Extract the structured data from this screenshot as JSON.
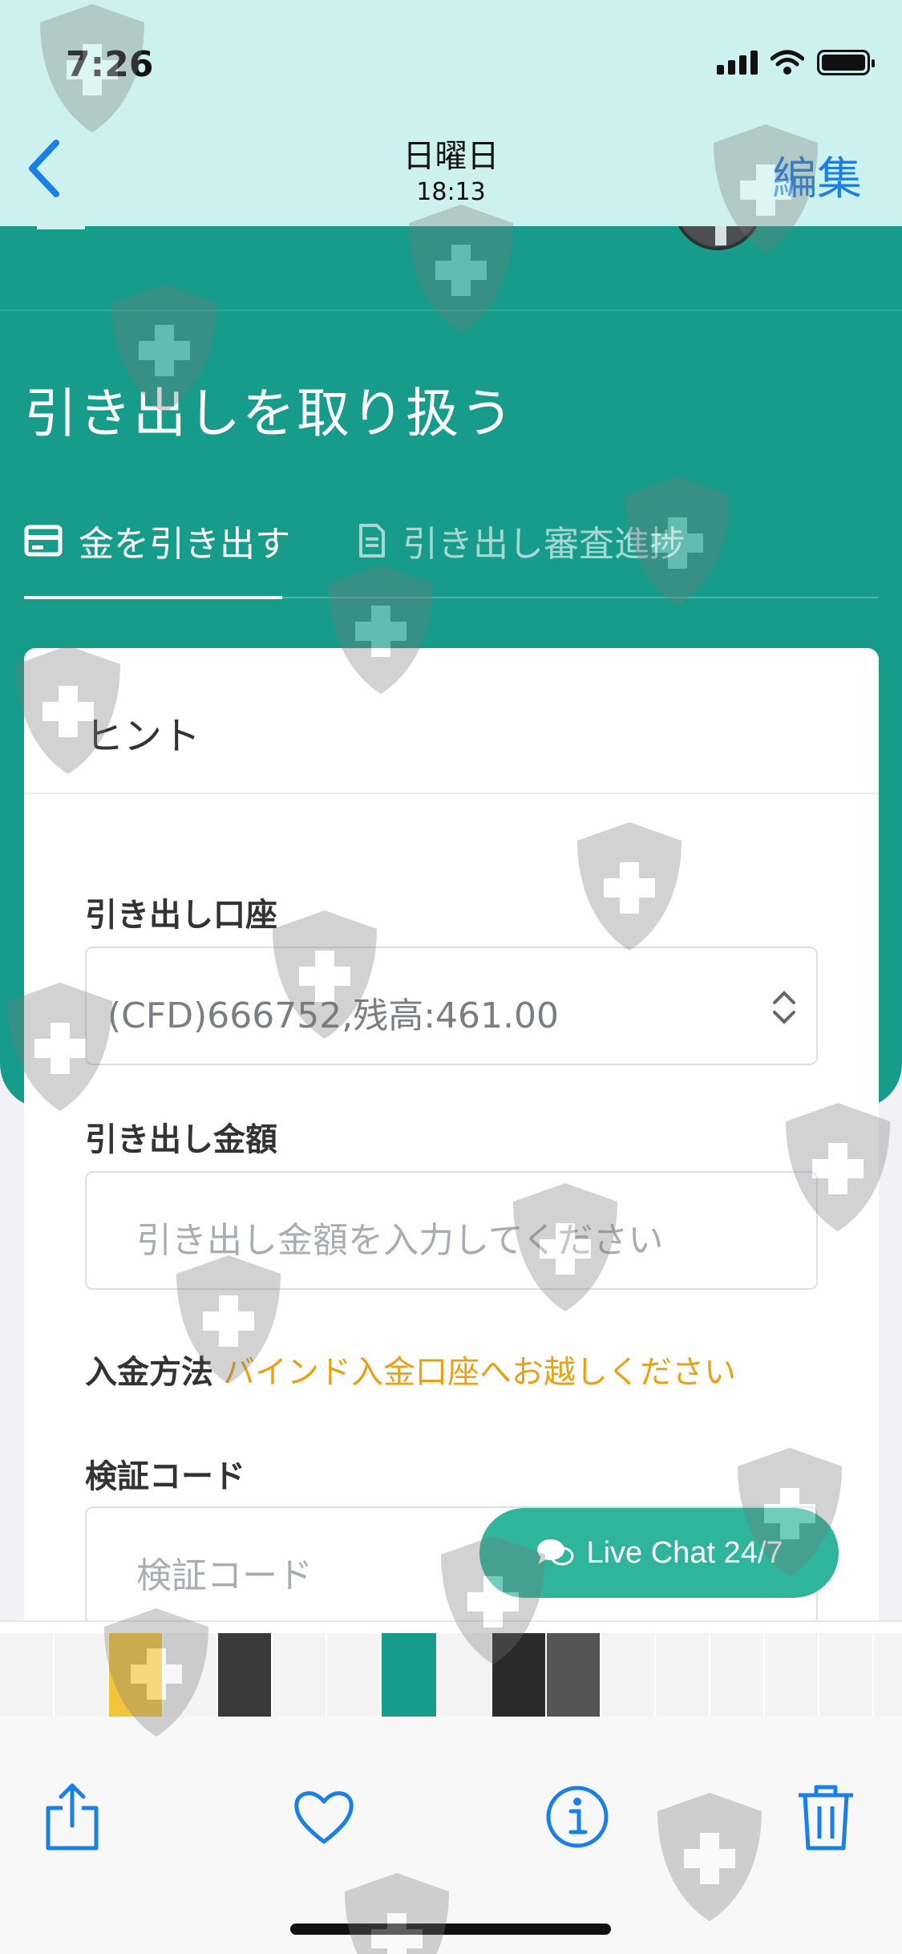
{
  "status_bar": {
    "time": "7:26",
    "icons": [
      "signal-icon",
      "wifi-icon",
      "battery-icon"
    ]
  },
  "photo_nav": {
    "back_icon": "chevron-left-icon",
    "title": "日曜日",
    "subtitle": "18:13",
    "edit_label": "編集"
  },
  "app": {
    "title": "引き出しを取り扱う",
    "tabs": [
      {
        "icon": "credit-card-icon",
        "label": "金を引き出す",
        "active": true
      },
      {
        "icon": "document-icon",
        "label": "引き出し審査進捗",
        "active": false
      }
    ],
    "card": {
      "header": "ヒント",
      "account_label": "引き出し口座",
      "account_value": "(CFD)666752,残高:461.00",
      "amount_label": "引き出し金額",
      "amount_placeholder": "引き出し金額を入力してください",
      "method_label": "入金方法",
      "method_value": "バインド入金口座へお越しください",
      "code_label": "検証コード",
      "code_placeholder": "検証コード"
    },
    "chat_button": "Live Chat 24/7"
  },
  "toolbar": {
    "icons": [
      "share-icon",
      "heart-icon",
      "info-icon",
      "trash-icon"
    ]
  },
  "colors": {
    "teal": "#179c8b",
    "ios_blue": "#1a7fe6",
    "orange": "#e9a215",
    "chat_green": "#2fb59c",
    "status_bg": "#cdf1ee"
  }
}
